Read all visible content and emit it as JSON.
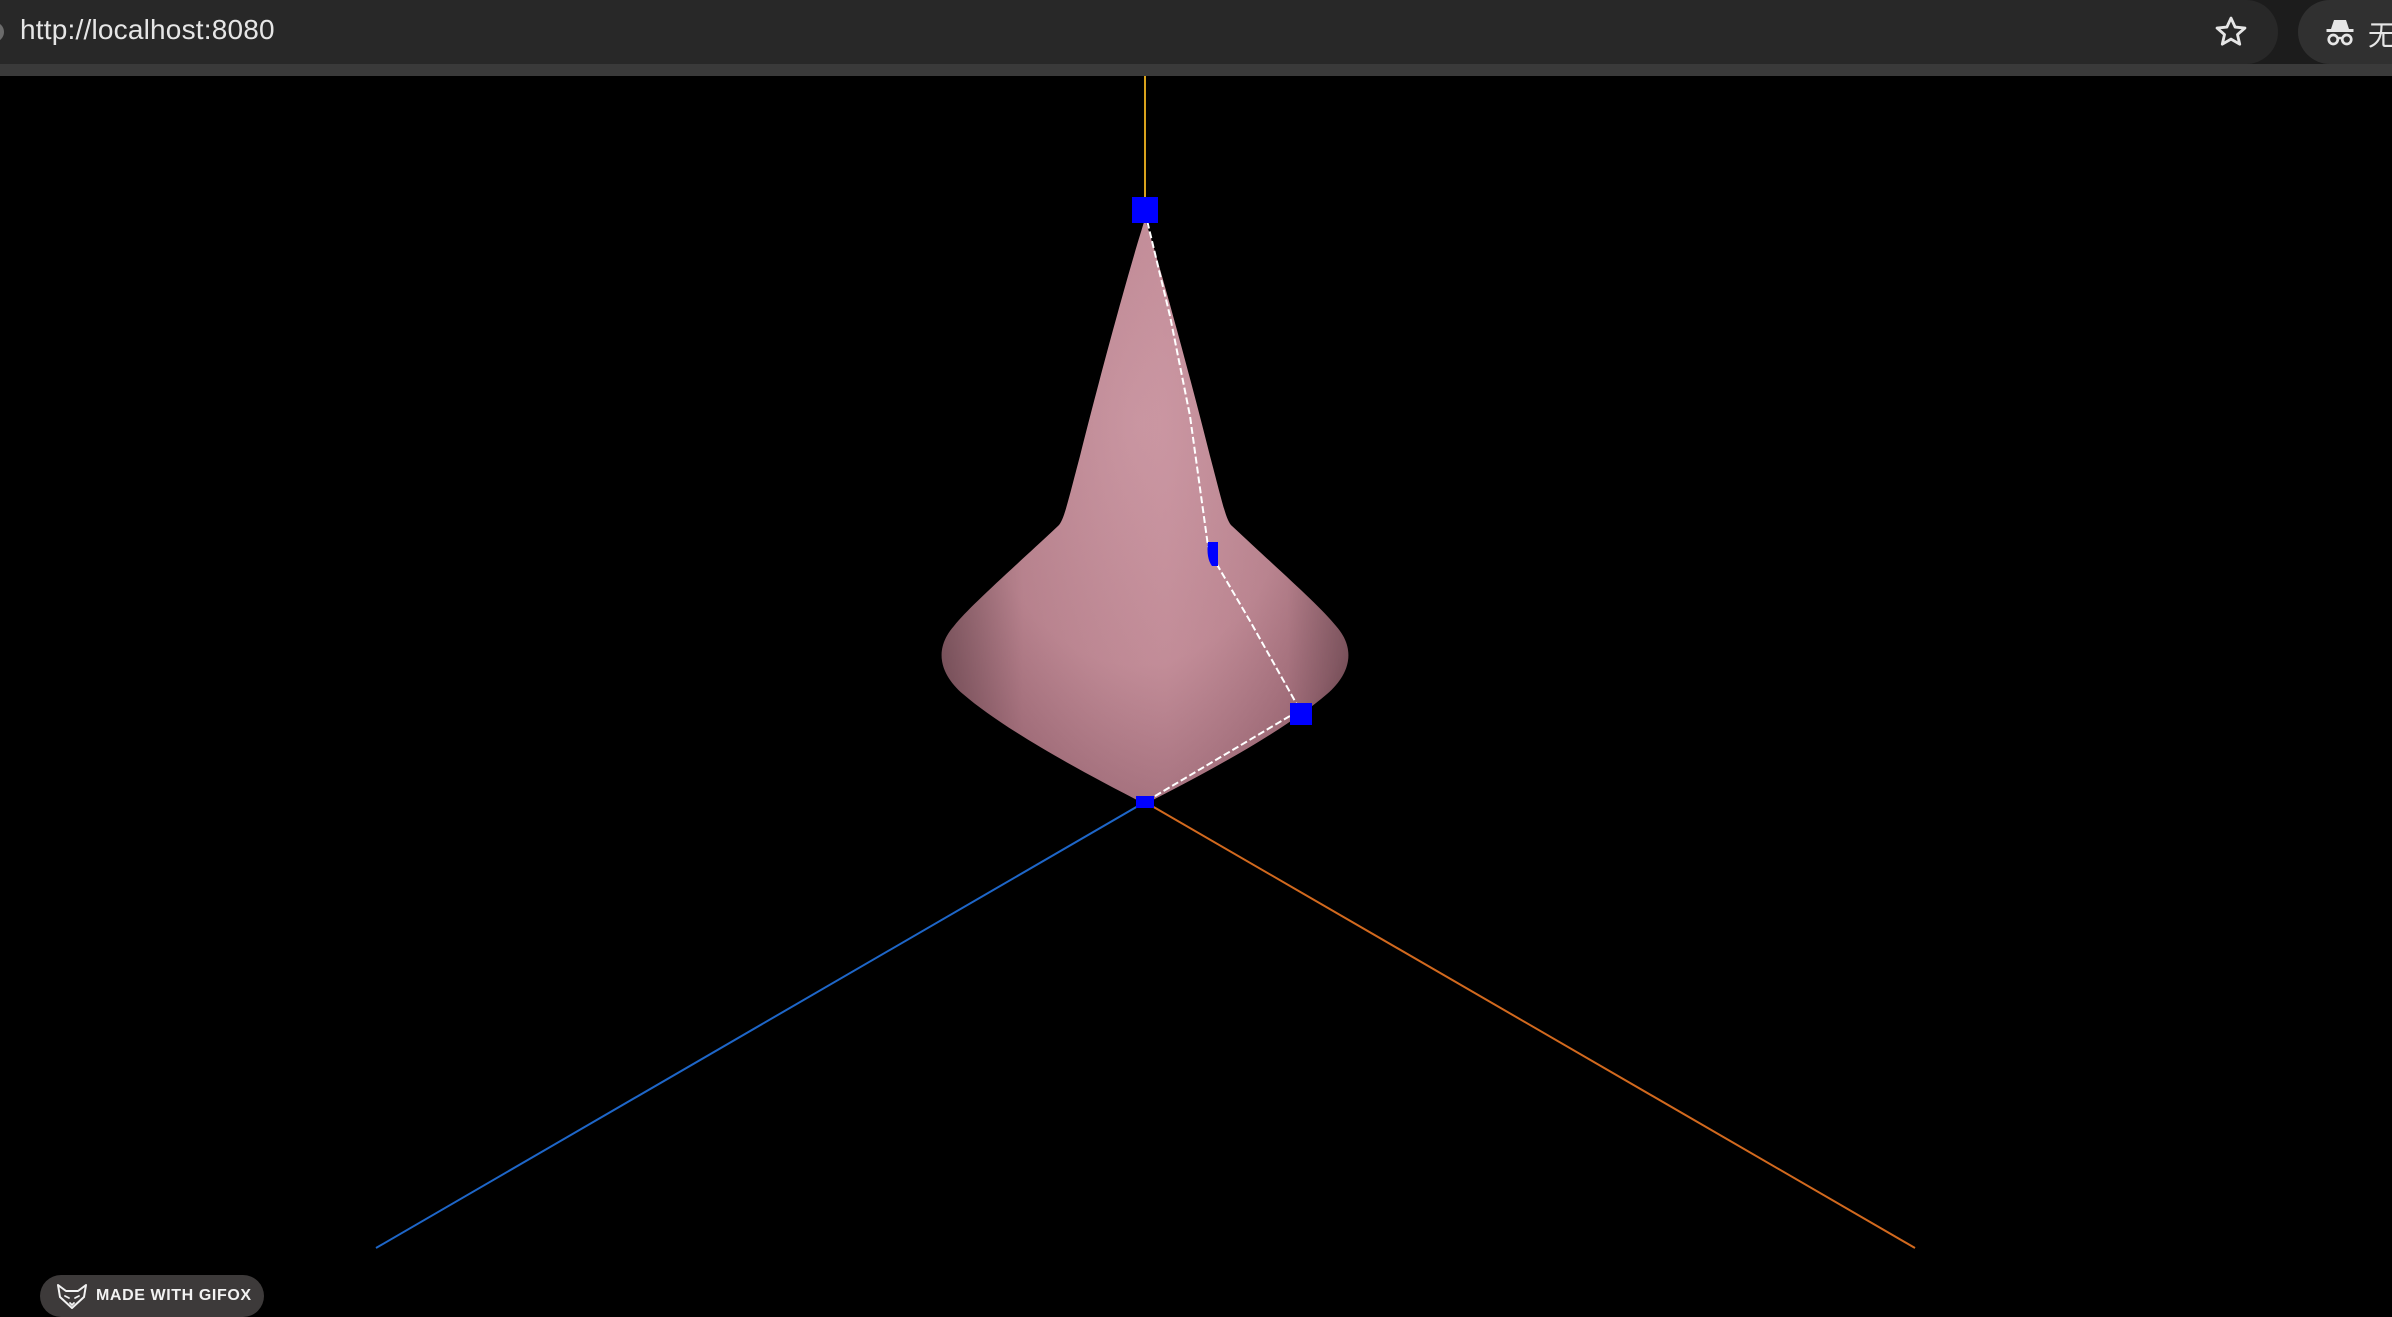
{
  "browser": {
    "url": "http://localhost:8080",
    "profile_label": "无",
    "icons": {
      "bookmark": "star-icon",
      "profile": "incognito-icon"
    }
  },
  "viewport": {
    "background": "#000000",
    "shape_color": "#c48a98",
    "control_point_color": "#0000ff",
    "profile_line_color": "#ffffff",
    "axes": [
      {
        "name": "y-axis",
        "color": "#d9a21c"
      },
      {
        "name": "x-axis",
        "color": "#1e66c8"
      },
      {
        "name": "z-axis",
        "color": "#d2691e"
      }
    ]
  },
  "watermark": {
    "text": "MADE WITH GIFOX",
    "icon": "fox-icon"
  }
}
